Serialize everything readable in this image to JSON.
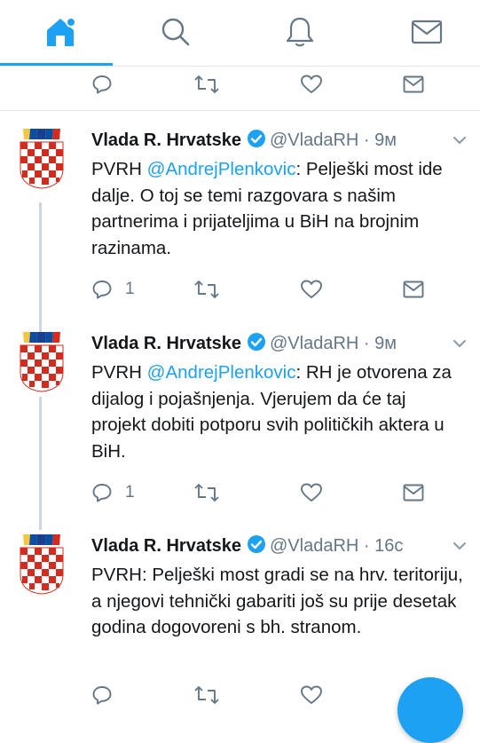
{
  "nav": {
    "tabs": [
      {
        "icon": "home-icon",
        "active": true
      },
      {
        "icon": "search-icon",
        "active": false
      },
      {
        "icon": "notifications-bell-icon",
        "active": false
      },
      {
        "icon": "messages-envelope-icon",
        "active": false
      }
    ],
    "accent_color": "#1da1f2"
  },
  "tweets": [
    {
      "name": "Vlada R. Hrvatske",
      "handle": "@VladaRH",
      "separator": " · ",
      "time": "9м",
      "prefix": "PVRH ",
      "mention": "@AndrejPlenkovic",
      "body": ": Pelješki most ide dalje. O toj se temi razgovara s našim partnerima i prijateljima u BiH na brojnim razinama.",
      "reply_count": "1"
    },
    {
      "name": "Vlada R. Hrvatske",
      "handle": "@VladaRH",
      "separator": " · ",
      "time": "9м",
      "prefix": "PVRH ",
      "mention": "@AndrejPlenkovic",
      "body": ": RH je otvorena za dijalog i pojašnjenja. Vjerujem da će taj projekt dobiti potporu svih političkih aktera u BiH.",
      "reply_count": "1"
    },
    {
      "name": "Vlada R. Hrvatske",
      "handle": "@VladaRH",
      "separator": " · ",
      "time": "16с",
      "prefix": "",
      "mention": "",
      "body": "PVRH: Pelješki most gradi se na hrv. teritoriju, a njegovi tehnički gabariti još su prije desetak godina dogovoreni s bh. stranom.",
      "reply_count": ""
    }
  ]
}
